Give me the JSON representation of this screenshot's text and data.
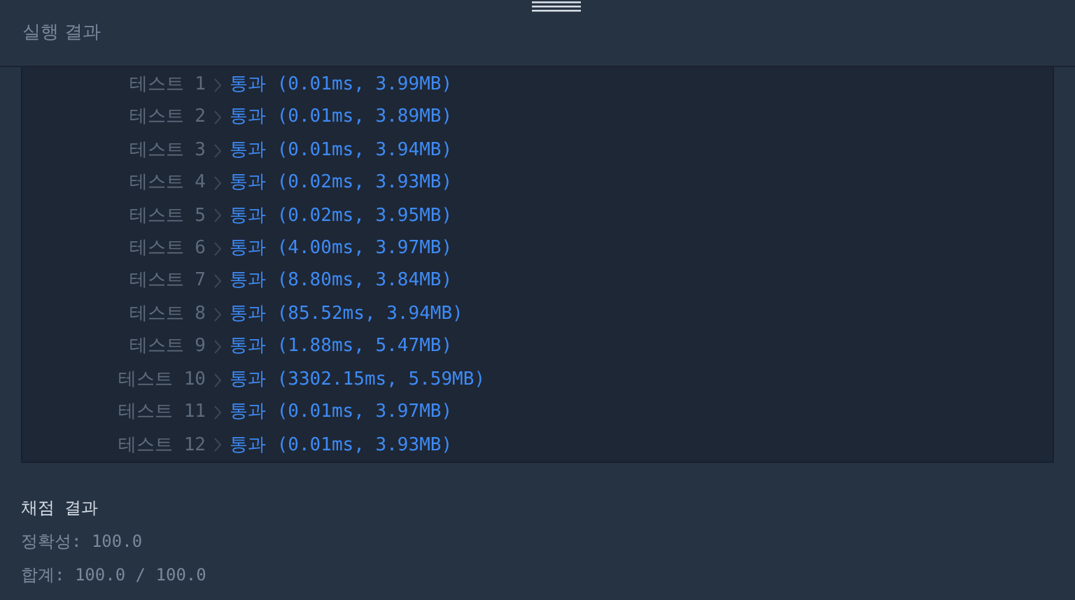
{
  "panel": {
    "title": "실행 결과"
  },
  "tests": [
    {
      "label": "테스트 1",
      "result": "통과 (0.01ms, 3.99MB)"
    },
    {
      "label": "테스트 2",
      "result": "통과 (0.01ms, 3.89MB)"
    },
    {
      "label": "테스트 3",
      "result": "통과 (0.01ms, 3.94MB)"
    },
    {
      "label": "테스트 4",
      "result": "통과 (0.02ms, 3.93MB)"
    },
    {
      "label": "테스트 5",
      "result": "통과 (0.02ms, 3.95MB)"
    },
    {
      "label": "테스트 6",
      "result": "통과 (4.00ms, 3.97MB)"
    },
    {
      "label": "테스트 7",
      "result": "통과 (8.80ms, 3.84MB)"
    },
    {
      "label": "테스트 8",
      "result": "통과 (85.52ms, 3.94MB)"
    },
    {
      "label": "테스트 9",
      "result": "통과 (1.88ms, 5.47MB)"
    },
    {
      "label": "테스트 10",
      "result": "통과 (3302.15ms, 5.59MB)"
    },
    {
      "label": "테스트 11",
      "result": "통과 (0.01ms, 3.97MB)"
    },
    {
      "label": "테스트 12",
      "result": "통과 (0.01ms, 3.93MB)"
    }
  ],
  "grading": {
    "title": "채점 결과",
    "lines": [
      "정확성: 100.0",
      "합계: 100.0 / 100.0"
    ]
  }
}
